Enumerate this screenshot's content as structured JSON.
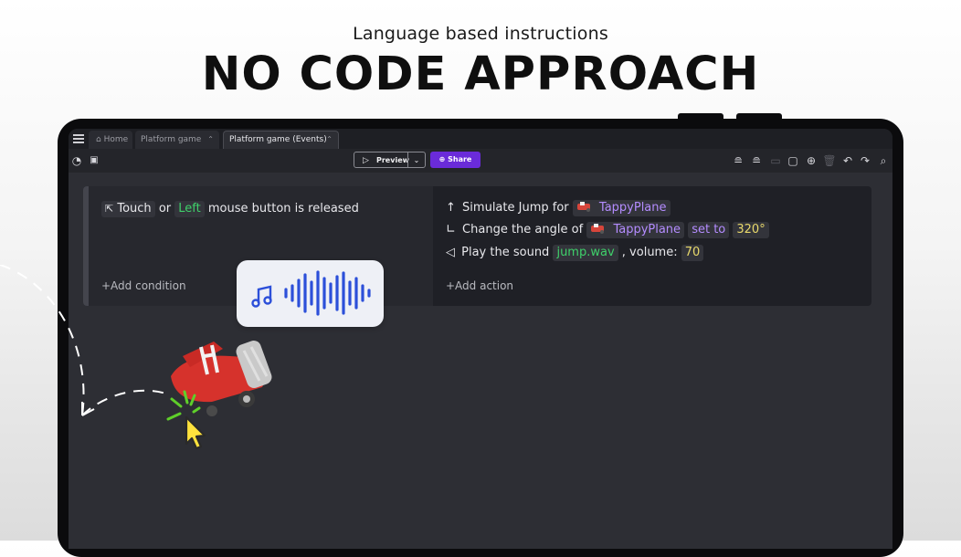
{
  "header": {
    "subtitle": "Language based instructions",
    "title": "NO CODE APPROACH"
  },
  "tabs": [
    {
      "label": "Home",
      "icon": "home-icon"
    },
    {
      "label": "Platform game"
    },
    {
      "label": "Platform game (Events)",
      "active": true
    }
  ],
  "toolbar": {
    "preview_label": "Preview",
    "share_label": "Share",
    "share_color": "#6a2bd9"
  },
  "event": {
    "condition": {
      "chip1": "Touch",
      "or": "or",
      "chip2": "Left",
      "rest": "mouse button is released"
    },
    "add_condition": "+Add condition",
    "actions": [
      {
        "icon": "arrow-up-icon",
        "text": "Simulate Jump for",
        "object": "TappyPlane"
      },
      {
        "icon": "angle-icon",
        "text": "Change the angle of",
        "object": "TappyPlane",
        "op": "set to",
        "value": "320°"
      },
      {
        "icon": "speaker-icon",
        "text": "Play the sound",
        "file": "jump.wav",
        "sep": ", volume:",
        "volume": "70"
      }
    ],
    "add_action": "+Add action"
  },
  "colors": {
    "green": "#3fd06a",
    "purple": "#b48cff",
    "yellow": "#e9d96b"
  }
}
